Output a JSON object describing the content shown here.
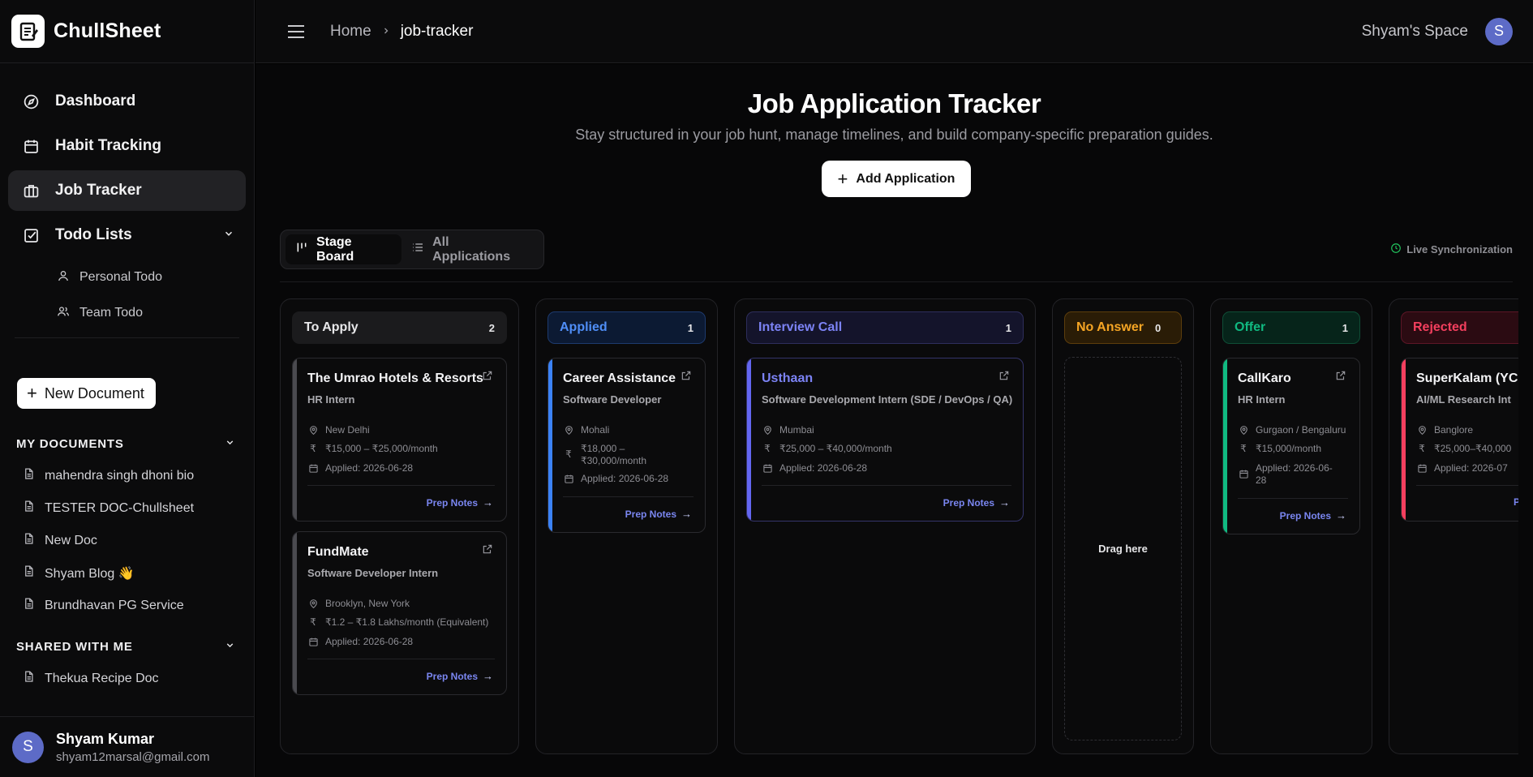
{
  "app": {
    "name": "ChullSheet"
  },
  "sidebar": {
    "nav": [
      {
        "label": "Dashboard"
      },
      {
        "label": "Habit Tracking"
      },
      {
        "label": "Job Tracker"
      },
      {
        "label": "Todo Lists"
      }
    ],
    "todo_sub": [
      {
        "label": "Personal Todo"
      },
      {
        "label": "Team Todo"
      }
    ],
    "new_document": "New Document",
    "my_documents_title": "MY DOCUMENTS",
    "my_documents": [
      {
        "label": "mahendra singh dhoni bio"
      },
      {
        "label": "TESTER DOC-Chullsheet"
      },
      {
        "label": "New Doc"
      },
      {
        "label": "Shyam Blog 👋"
      },
      {
        "label": "Brundhavan PG Service"
      }
    ],
    "shared_title": "SHARED WITH ME",
    "shared": [
      {
        "label": "Thekua Recipe Doc"
      }
    ],
    "user": {
      "initial": "S",
      "name": "Shyam Kumar",
      "email": "shyam12marsal@gmail.com"
    }
  },
  "topbar": {
    "breadcrumb": {
      "home": "Home",
      "current": "job-tracker"
    },
    "space": "Shyam's Space",
    "avatar_initial": "S"
  },
  "main": {
    "title": "Job Application Tracker",
    "subtitle": "Stay structured in your job hunt, manage timelines, and build company-specific preparation guides.",
    "add_button": "Add Application",
    "tabs": [
      {
        "label": "Stage Board"
      },
      {
        "label": "All Applications"
      }
    ],
    "sync_label": "Live Synchronization",
    "drag_here": "Drag here",
    "prep_notes": "Prep Notes"
  },
  "columns": [
    {
      "name": "To Apply",
      "count": "2",
      "color": "#e8e8ea"
    },
    {
      "name": "Applied",
      "count": "1",
      "color": "#3b82f6"
    },
    {
      "name": "Interview Call",
      "count": "1",
      "color": "#6366f1"
    },
    {
      "name": "No Answer",
      "count": "0",
      "color": "#f59e0b"
    },
    {
      "name": "Offer",
      "count": "1",
      "color": "#10b981"
    },
    {
      "name": "Rejected",
      "count": "",
      "color": "#f43f5e"
    }
  ],
  "cards": {
    "to_apply": [
      {
        "company": "The Umrao Hotels & Resorts",
        "role": "HR Intern",
        "location": "New Delhi",
        "salary": "₹15,000 – ₹25,000/month",
        "applied": "Applied: 2026-06-28"
      },
      {
        "company": "FundMate",
        "role": "Software Developer Intern",
        "location": "Brooklyn, New York",
        "salary": "₹1.2 – ₹1.8 Lakhs/month (Equivalent)",
        "applied": "Applied: 2026-06-28"
      }
    ],
    "applied": [
      {
        "company": "Career Assistance",
        "role": "Software Developer",
        "location": "Mohali",
        "salary_l1": "₹18,000 –",
        "salary_l2": "₹30,000/month",
        "applied": "Applied: 2026-06-28"
      }
    ],
    "interview": [
      {
        "company": "Usthaan",
        "role": "Software Development Intern (SDE / DevOps / QA)",
        "location": "Mumbai",
        "salary": "₹25,000 – ₹40,000/month",
        "applied": "Applied: 2026-06-28"
      }
    ],
    "offer": [
      {
        "company": "CallKaro",
        "role": "HR Intern",
        "location": "Gurgaon / Bengaluru",
        "salary": "₹15,000/month",
        "applied_l1": "Applied: 2026-06-",
        "applied_l2": "28"
      }
    ],
    "rejected": [
      {
        "company": "SuperKalam (YC",
        "role": "AI/ML Research Int",
        "location": "Banglore",
        "salary": "₹25,000–₹40,000",
        "applied": "Applied: 2026-07",
        "prep": "Pr"
      }
    ]
  },
  "colors": {
    "accent_prep": "#7a86f0",
    "avatar": "#5d6bc7",
    "sync_dot": "#22c55e"
  }
}
